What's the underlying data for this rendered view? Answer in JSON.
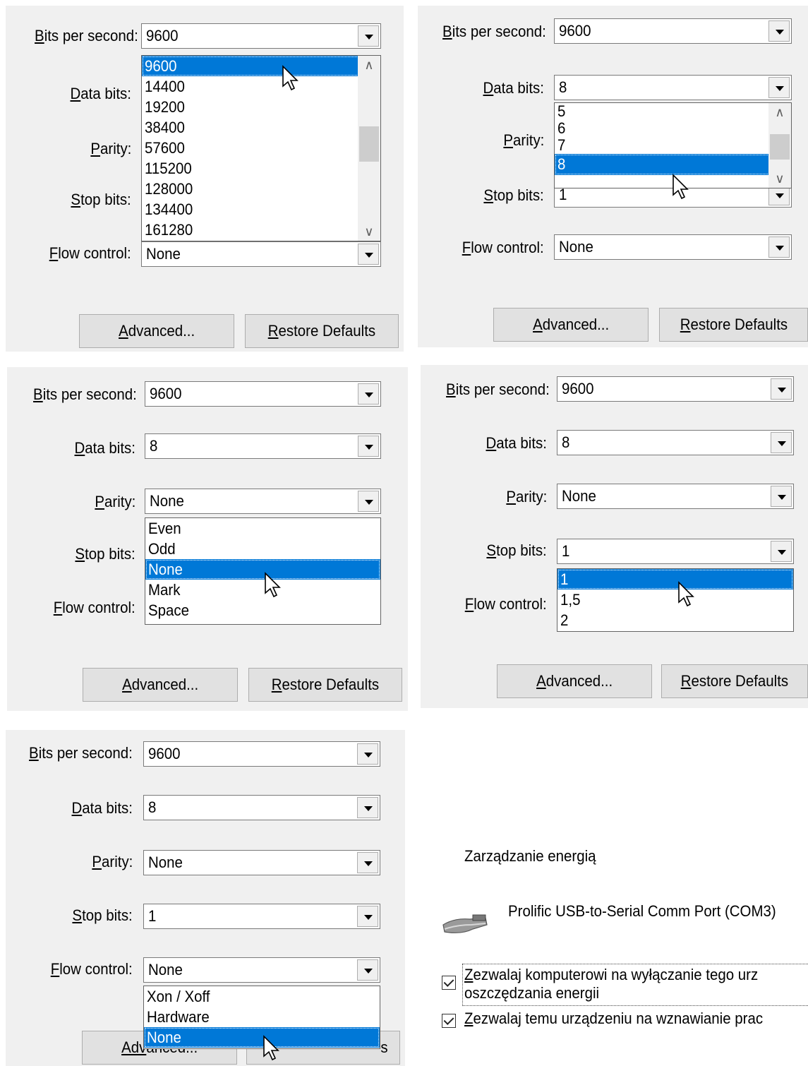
{
  "labels": {
    "bits_per_second": {
      "accel": "B",
      "rest": "its per second:"
    },
    "data_bits": {
      "accel": "D",
      "rest": "ata bits:"
    },
    "parity": {
      "accel": "P",
      "rest": "arity:"
    },
    "stop_bits": {
      "accel": "S",
      "rest": "top bits:"
    },
    "flow_control": {
      "accel": "F",
      "rest": "low control:"
    }
  },
  "values": {
    "bits_per_second": "9600",
    "data_bits": "8",
    "parity": "None",
    "stop_bits": "1",
    "flow_control": "None"
  },
  "buttons": {
    "advanced": {
      "accel": "A",
      "rest": "dvanced..."
    },
    "restore": {
      "accel": "R",
      "rest": "estore Defaults"
    },
    "advanced_partial": {
      "pre": "Adv",
      "post": "anced..."
    },
    "restore_partial": {
      "post": "s"
    }
  },
  "dropdowns": {
    "baud": [
      "9600",
      "14400",
      "19200",
      "38400",
      "57600",
      "115200",
      "128000",
      "134400",
      "161280"
    ],
    "data_bits": [
      "5",
      "6",
      "7",
      "8"
    ],
    "parity": [
      "Even",
      "Odd",
      "None",
      "Mark",
      "Space"
    ],
    "stop_bits": [
      "1",
      "1,5",
      "2"
    ],
    "flow_control": [
      "Xon / Xoff",
      "Hardware",
      "None"
    ]
  },
  "power": {
    "title": "Zarządzanie energią",
    "device": "Prolific USB-to-Serial Comm Port (COM3)",
    "check1_line1": {
      "accel": "Z",
      "rest": "ezwalaj komputerowi na wyłączanie tego urz"
    },
    "check1_line2": "oszczędzania energii",
    "check2": {
      "accel": "Z",
      "rest": "ezwalaj temu urządzeniu na wznawianie prac"
    },
    "check1_checked": true,
    "check2_checked": true
  },
  "colors": {
    "selection": "#0078d7",
    "dialog_bg": "#f0f0f0"
  }
}
